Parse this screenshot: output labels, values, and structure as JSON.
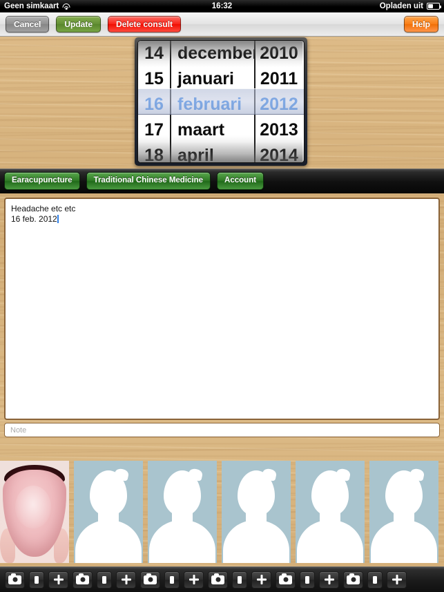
{
  "status_bar": {
    "carrier": "Geen simkaart",
    "wifi_icon": "wifi-icon",
    "time": "16:32",
    "battery_label": "Opladen uit",
    "battery_icon": "battery-icon"
  },
  "nav_bar": {
    "cancel_label": "Cancel",
    "update_label": "Update",
    "delete_label": "Delete consult",
    "help_label": "Help"
  },
  "date_picker": {
    "selected_day": "16",
    "selected_month": "februari",
    "selected_year": "2012",
    "days": [
      "14",
      "15",
      "16",
      "17",
      "18"
    ],
    "months": [
      "december",
      "januari",
      "februari",
      "maart",
      "april"
    ],
    "years": [
      "2010",
      "2011",
      "2012",
      "2013",
      "2014"
    ],
    "selected_index": 2,
    "selection_text_color": "#2f7fe6",
    "selection_band_color": "#c4cce2"
  },
  "tabs": [
    {
      "label": "Earacupuncture"
    },
    {
      "label": "Traditional Chinese Medicine"
    },
    {
      "label": "Account"
    }
  ],
  "tab_color": "#2e7a25",
  "notes_editor": {
    "line1": "Headache etc etc",
    "line2": "16 feb. 2012",
    "caret_color": "#2f7fe6"
  },
  "note_field": {
    "value": "",
    "placeholder": "Note"
  },
  "thumbnails": [
    {
      "type": "photo",
      "name": "tongue-photo"
    },
    {
      "type": "placeholder",
      "name": "person-placeholder"
    },
    {
      "type": "placeholder",
      "name": "person-placeholder"
    },
    {
      "type": "placeholder",
      "name": "person-placeholder"
    },
    {
      "type": "placeholder",
      "name": "person-placeholder"
    },
    {
      "type": "placeholder",
      "name": "person-placeholder"
    }
  ],
  "toolbar": {
    "groups": 6,
    "buttons": [
      "camera-icon",
      "photo-library-icon",
      "plus-icon"
    ]
  },
  "colors": {
    "wood": "#d6b481",
    "dark_bar": "#111111",
    "green": "#2e7a25",
    "red": "#f82015",
    "orange": "#f97d16",
    "grey": "#909090"
  }
}
